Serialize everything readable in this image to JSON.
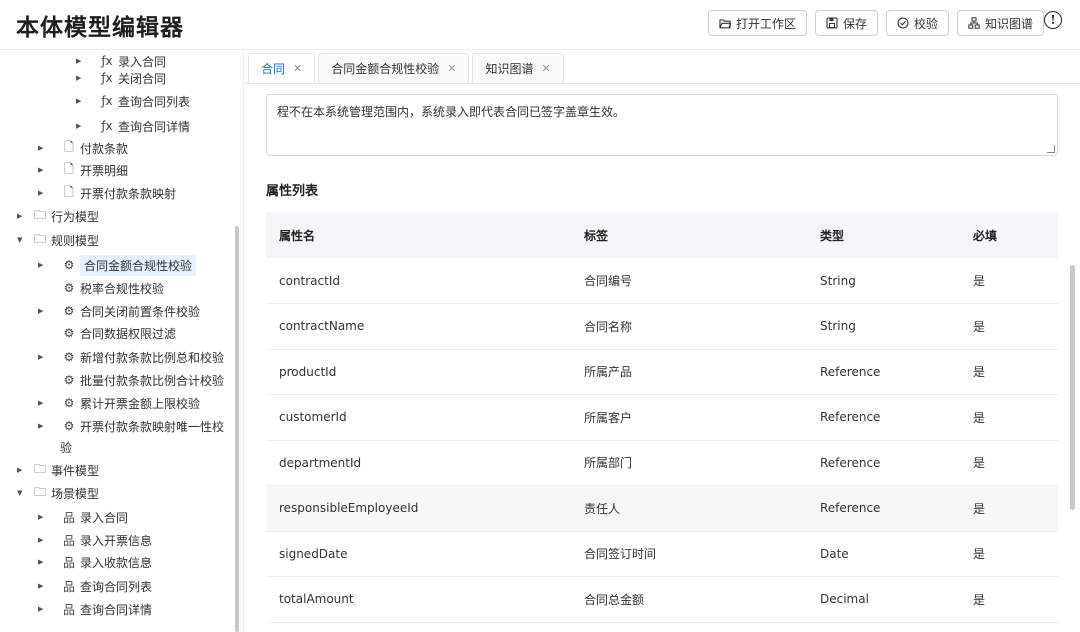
{
  "app": {
    "title": "本体模型编辑器"
  },
  "toolbar": {
    "open_workspace": "打开工作区",
    "save": "保存",
    "validate": "校验",
    "knowledge_graph": "知识图谱"
  },
  "sidebar": {
    "items": [
      {
        "label": "录入合同",
        "type": "function"
      },
      {
        "label": "关闭合同",
        "type": "function"
      },
      {
        "label": "查询合同列表",
        "type": "function"
      },
      {
        "label": "查询合同详情",
        "type": "function"
      },
      {
        "label": "付款条款",
        "type": "doc"
      },
      {
        "label": "开票明细",
        "type": "doc"
      },
      {
        "label": "开票付款条款映射",
        "type": "doc"
      },
      {
        "label": "行为模型",
        "type": "folder"
      },
      {
        "label": "规则模型",
        "type": "folder"
      },
      {
        "label": "合同金额合规性校验",
        "type": "rule"
      },
      {
        "label": "税率合规性校验",
        "type": "rule"
      },
      {
        "label": "合同关闭前置条件校验",
        "type": "rule"
      },
      {
        "label": "合同数据权限过滤",
        "type": "rule"
      },
      {
        "label": "新增付款条款比例总和校验",
        "type": "rule"
      },
      {
        "label": "批量付款条款比例合计校验",
        "type": "rule"
      },
      {
        "label": "累计开票金额上限校验",
        "type": "rule"
      },
      {
        "label": "开票付款条款映射唯一性校",
        "type": "rule"
      },
      {
        "label": "验",
        "type": "wrap"
      },
      {
        "label": "事件模型",
        "type": "folder"
      },
      {
        "label": "场景模型",
        "type": "folder"
      },
      {
        "label": "录入合同",
        "type": "scene"
      },
      {
        "label": "录入开票信息",
        "type": "scene"
      },
      {
        "label": "录入收款信息",
        "type": "scene"
      },
      {
        "label": "查询合同列表",
        "type": "scene"
      },
      {
        "label": "查询合同详情",
        "type": "scene"
      }
    ]
  },
  "tabs": [
    {
      "label": "合同",
      "active": true
    },
    {
      "label": "合同金额合规性校验",
      "active": false
    },
    {
      "label": "知识图谱",
      "active": false
    }
  ],
  "main": {
    "description": "程不在本系统管理范围内，系统录入即代表合同已签字盖章生效。",
    "section_title": "属性列表",
    "table": {
      "headers": [
        "属性名",
        "标签",
        "类型",
        "必填"
      ],
      "rows": [
        [
          "contractId",
          "合同编号",
          "String",
          "是"
        ],
        [
          "contractName",
          "合同名称",
          "String",
          "是"
        ],
        [
          "productId",
          "所属产品",
          "Reference",
          "是"
        ],
        [
          "customerId",
          "所属客户",
          "Reference",
          "是"
        ],
        [
          "departmentId",
          "所属部门",
          "Reference",
          "是"
        ],
        [
          "responsibleEmployeeId",
          "责任人",
          "Reference",
          "是"
        ],
        [
          "signedDate",
          "合同签订时间",
          "Date",
          "是"
        ],
        [
          "totalAmount",
          "合同总金额",
          "Decimal",
          "是"
        ]
      ]
    }
  },
  "icons": {
    "function": "ƒx",
    "doc": "🗋",
    "folder": "🗀",
    "rule": "⚙",
    "scene": "品"
  },
  "colors": {
    "accent": "#1a6cff",
    "selected_bg": "#e6f0ff"
  }
}
